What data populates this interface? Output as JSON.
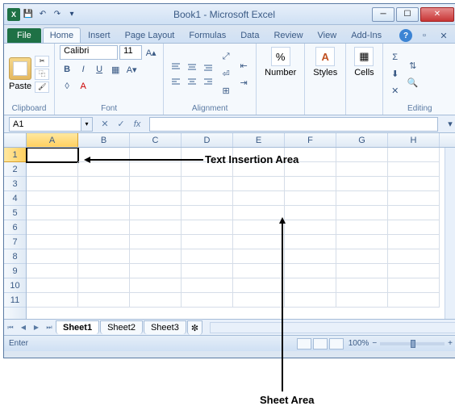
{
  "window": {
    "title": "Book1 - Microsoft Excel"
  },
  "qat": {
    "save": "💾",
    "undo": "↶",
    "redo": "↷"
  },
  "tabs": {
    "file": "File",
    "items": [
      "Home",
      "Insert",
      "Page Layout",
      "Formulas",
      "Data",
      "Review",
      "View",
      "Add-Ins"
    ],
    "active": "Home"
  },
  "ribbon": {
    "clipboard": {
      "paste": "Paste",
      "label": "Clipboard"
    },
    "font": {
      "name": "Calibri",
      "size": "11",
      "bold": "B",
      "italic": "I",
      "underline": "U",
      "label": "Font"
    },
    "alignment": {
      "label": "Alignment"
    },
    "number": {
      "btn": "Number",
      "symbol": "%",
      "label": ""
    },
    "styles": {
      "btn": "Styles",
      "icon": "A"
    },
    "cells": {
      "btn": "Cells"
    },
    "editing": {
      "sigma": "Σ",
      "fill": "⬇",
      "clear": "✕",
      "label": "Editing"
    }
  },
  "namebox": {
    "value": "A1",
    "fx": "fx",
    "cancel": "✕",
    "enter": "✓"
  },
  "columns": [
    "A",
    "B",
    "C",
    "D",
    "E",
    "F",
    "G",
    "H"
  ],
  "rows": [
    "1",
    "2",
    "3",
    "4",
    "5",
    "6",
    "7",
    "8",
    "9",
    "10",
    "11"
  ],
  "selected_cell": "A1",
  "sheet_tabs": {
    "tabs": [
      "Sheet1",
      "Sheet2",
      "Sheet3"
    ],
    "active": "Sheet1",
    "new": "+"
  },
  "statusbar": {
    "mode": "Enter",
    "zoom": "100%"
  },
  "annotations": {
    "text_insertion": "Text Insertion Area",
    "sheet_area": "Sheet Area"
  }
}
